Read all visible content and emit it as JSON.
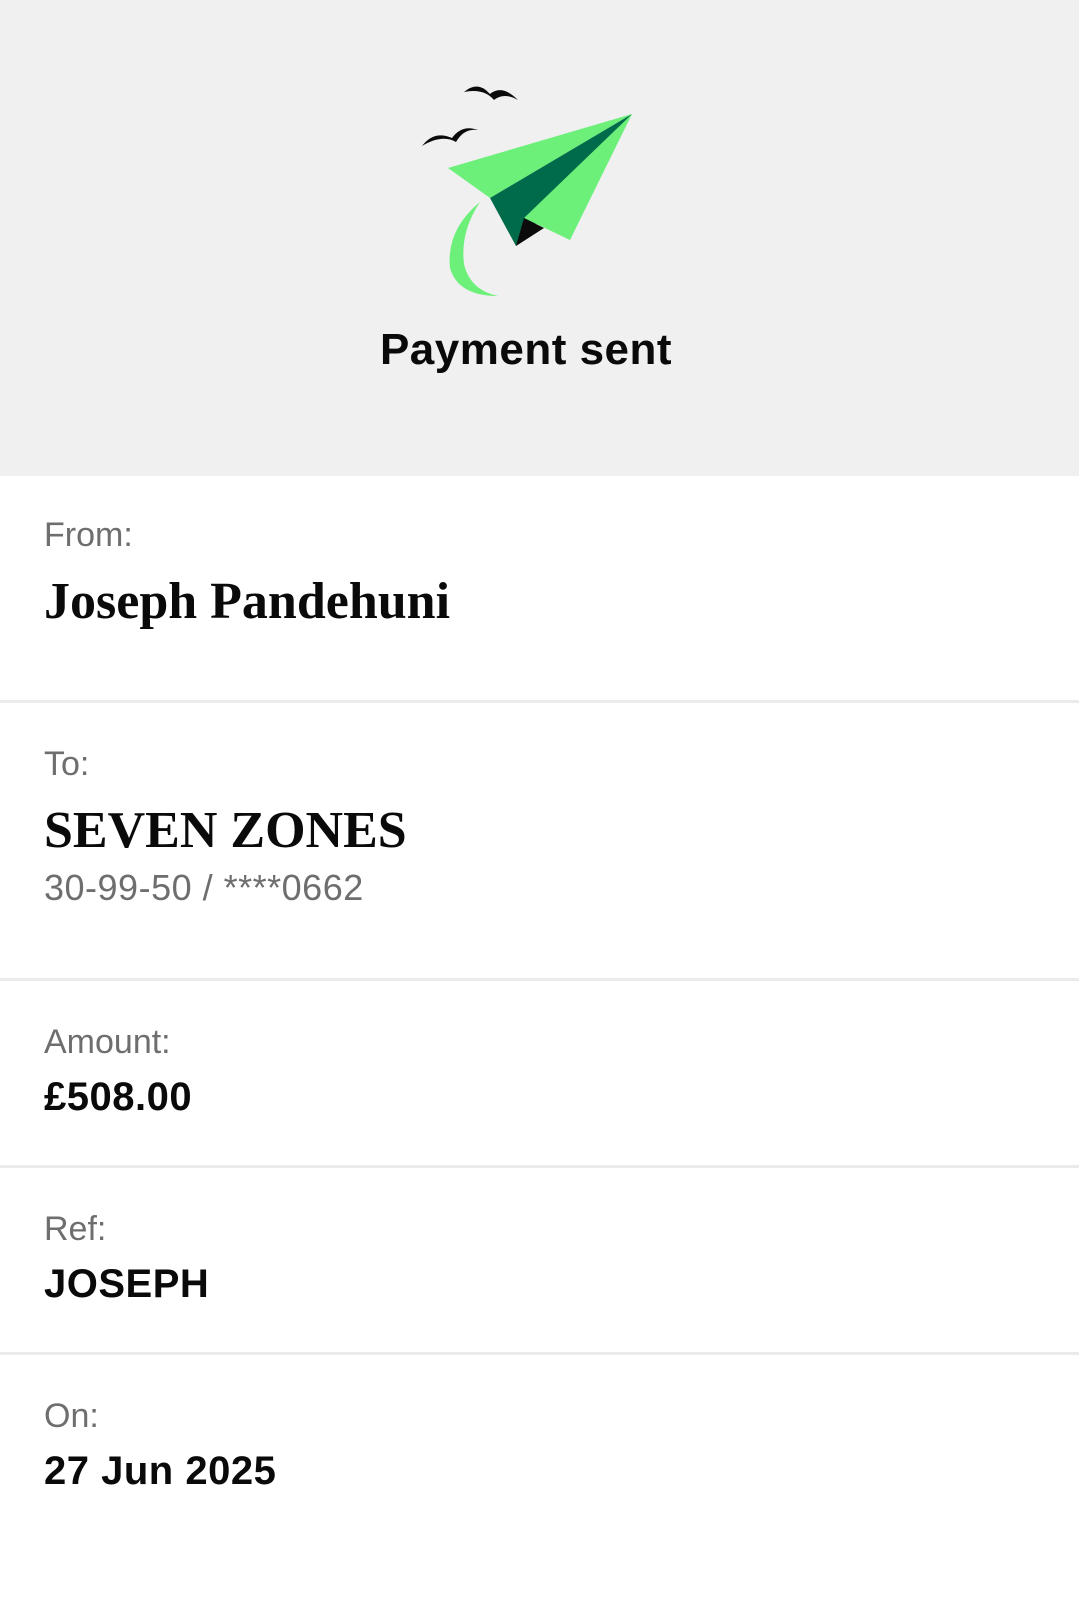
{
  "header": {
    "title": "Payment sent",
    "icon": "paper-plane-icon",
    "colors": {
      "background": "#f0f0f0",
      "plane_light": "#6cf07a",
      "plane_dark": "#006b4a"
    }
  },
  "details": {
    "from": {
      "label": "From:",
      "name": "Joseph Pandehuni"
    },
    "to": {
      "label": "To:",
      "name": "SEVEN ZONES",
      "account": "30-99-50 / ****0662"
    },
    "amount": {
      "label": "Amount:",
      "value": "£508.00"
    },
    "ref": {
      "label": "Ref:",
      "value": "JOSEPH"
    },
    "on": {
      "label": "On:",
      "value": "27 Jun 2025"
    }
  }
}
